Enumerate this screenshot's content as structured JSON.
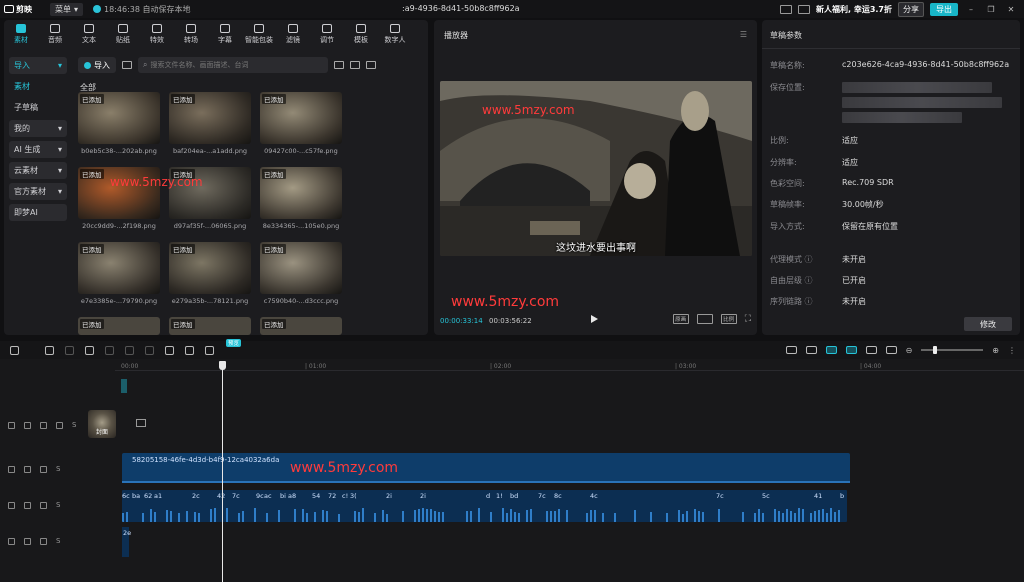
{
  "titlebar": {
    "app_name": "剪映",
    "menu_label": "菜单",
    "autosave": "18:46:38 自动保存本地",
    "doc_title": ":a9-4936-8d41-50b8c8ff962a",
    "promo": "新人福利, 幸运3.7折",
    "share_label": "分享",
    "export_label": "导出"
  },
  "toolbar": {
    "items": [
      {
        "label": "素材",
        "icon": "media-icon"
      },
      {
        "label": "音频",
        "icon": "audio-icon"
      },
      {
        "label": "文本",
        "icon": "text-icon"
      },
      {
        "label": "贴纸",
        "icon": "sticker-icon"
      },
      {
        "label": "特效",
        "icon": "effects-icon"
      },
      {
        "label": "转场",
        "icon": "transition-icon"
      },
      {
        "label": "字幕",
        "icon": "subtitle-icon"
      },
      {
        "label": "智能包装",
        "icon": "smart-pack-icon"
      },
      {
        "label": "滤镜",
        "icon": "filter-icon"
      },
      {
        "label": "调节",
        "icon": "adjust-icon"
      },
      {
        "label": "模板",
        "icon": "template-icon"
      },
      {
        "label": "数字人",
        "icon": "avatar-icon"
      }
    ]
  },
  "sidenav": {
    "items": [
      {
        "label": "导入",
        "chevron": "▾"
      },
      {
        "label": "素材",
        "chevron": ""
      },
      {
        "label": "子草稿",
        "chevron": ""
      },
      {
        "label": "我的",
        "chevron": "▾"
      },
      {
        "label": "AI 生成",
        "chevron": "▾"
      },
      {
        "label": "云素材",
        "chevron": "▾"
      },
      {
        "label": "官方素材",
        "chevron": "▾"
      },
      {
        "label": "即梦AI",
        "chevron": ""
      }
    ]
  },
  "media": {
    "import_label": "导入",
    "search_placeholder": "搜索文件名称、画面描述、台词",
    "all_label": "全部",
    "added_badge": "已添加",
    "thumbs": [
      {
        "name": "b0eb5c38-...202ab.png"
      },
      {
        "name": "baf204ea-...a1add.png"
      },
      {
        "name": "09427c00-...c57fe.png"
      },
      {
        "name": "20cc9dd9-...2f198.png"
      },
      {
        "name": "d97af35f-...06065.png"
      },
      {
        "name": "8e334365-...105e0.png"
      },
      {
        "name": "e7e3385e-...79790.png"
      },
      {
        "name": "e279a35b-...78121.png"
      },
      {
        "name": "c7590b40-...d3ccc.png"
      }
    ],
    "watermark": "www.5mzy.com"
  },
  "player": {
    "title": "播放器",
    "subtitle": "这坟进水要出事啊",
    "watermark_video": "www.5mzy.com",
    "watermark_panel": "www.5mzy.com",
    "time_current": "00:00:33:14",
    "time_total": "00:03:56:22",
    "ctrl_fit": "原画",
    "ctrl_ratio": "比例"
  },
  "props": {
    "title": "草稿参数",
    "rows": [
      {
        "k": "草稿名称:",
        "v": "c203e626-4ca9-4936-8d41-50b8c8ff962a"
      },
      {
        "k": "保存位置:",
        "v": ""
      },
      {
        "k": "比例:",
        "v": "适应"
      },
      {
        "k": "分辨率:",
        "v": "适应"
      },
      {
        "k": "色彩空间:",
        "v": "Rec.709 SDR"
      },
      {
        "k": "草稿帧率:",
        "v": "30.00帧/秒"
      },
      {
        "k": "导入方式:",
        "v": "保留在原有位置"
      },
      {
        "k": "代理模式 ⓘ",
        "v": "未开启"
      },
      {
        "k": "自由层级 ⓘ",
        "v": "已开启"
      },
      {
        "k": "序列链路 ⓘ",
        "v": "未开启"
      }
    ],
    "modify_label": "修改"
  },
  "timeline": {
    "ticks": [
      "00:00",
      "| 01:00",
      "| 02:00",
      "| 03:00",
      "| 04:00"
    ],
    "cover_label": "封面",
    "main_clip_label": "58205158-46fe-4d3d-b4f9-12ca4032a6da",
    "watermark": "www.5mzy.com",
    "badge": "预览",
    "sub_labels": [
      "6c",
      "ba",
      "62",
      "a1",
      "2c",
      "42",
      "7c",
      "9c",
      "ac",
      "bi",
      "a8",
      "54",
      "72",
      "c!",
      "3(",
      "2i",
      "2i",
      "d",
      "1!",
      "bd",
      "7c",
      "8c",
      "4c",
      "7c",
      "5c",
      "41",
      "b"
    ],
    "sfx_label": "2e",
    "track_s": "S"
  },
  "colors": {
    "accent": "#27c4d8",
    "clip_blue": "#0e3d6a",
    "watermark_red": "#ff3b3b"
  }
}
